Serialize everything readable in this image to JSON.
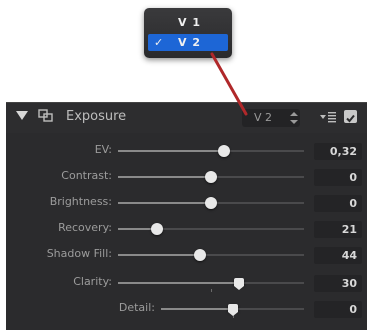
{
  "version_popup": {
    "items": [
      {
        "label": "V 1",
        "checked": false
      },
      {
        "label": "V 2",
        "checked": true,
        "check_mark": "✓"
      }
    ],
    "highlight_color": "#1d66d6"
  },
  "connector_color": "#b0282a",
  "panel": {
    "title": "Exposure",
    "version_selector": {
      "value": "V 2"
    },
    "enabled": true
  },
  "sliders": [
    {
      "label": "EV:",
      "value_text": "0,32",
      "level": 0.57,
      "thumb": "round"
    },
    {
      "label": "Contrast:",
      "value_text": "0",
      "level": 0.5,
      "thumb": "round"
    },
    {
      "label": "Brightness:",
      "value_text": "0",
      "level": 0.5,
      "thumb": "round"
    },
    {
      "label": "Recovery:",
      "value_text": "21",
      "level": 0.21,
      "thumb": "round"
    },
    {
      "label": "Shadow Fill:",
      "value_text": "44",
      "level": 0.44,
      "thumb": "round"
    },
    {
      "label": "Clarity:",
      "value_text": "30",
      "level": 0.65,
      "thumb": "pointer"
    },
    {
      "label": "Detail:",
      "value_text": "0",
      "level": 0.5,
      "thumb": "pointer"
    }
  ]
}
